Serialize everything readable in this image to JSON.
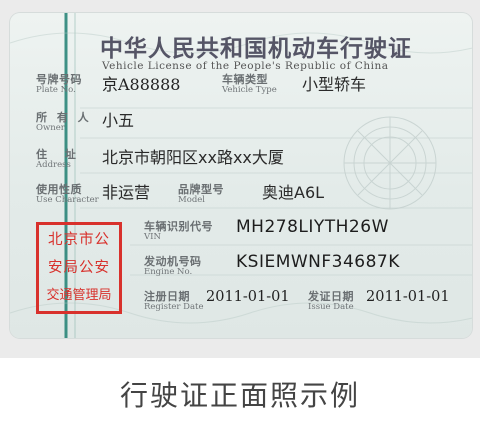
{
  "card": {
    "title_cn": "中华人民共和国机动车行驶证",
    "title_en": "Vehicle License of the People's Republic of China",
    "fields": {
      "plate": {
        "label_cn": "号牌号码",
        "label_en": "Plate No.",
        "value": "京A88888"
      },
      "vehicle_type": {
        "label_cn": "车辆类型",
        "label_en": "Vehicle Type",
        "value": "小型轿车"
      },
      "owner": {
        "label_cn": "所 有 人",
        "label_en": "Owner",
        "value": "小五"
      },
      "address": {
        "label_cn": "住    址",
        "label_en": "Address",
        "value": "北京市朝阳区xx路xx大厦"
      },
      "use_character": {
        "label_cn": "使用性质",
        "label_en": "Use Character",
        "value": "非运营"
      },
      "model": {
        "label_cn": "品牌型号",
        "label_en": "Model",
        "value": "奥迪A6L"
      },
      "vin": {
        "label_cn": "车辆识别代号",
        "label_en": "VIN",
        "value": "MH278LIYTH26W"
      },
      "engine": {
        "label_cn": "发动机号码",
        "label_en": "Engine No.",
        "value": "KSIEMWNF34687K"
      },
      "register_date": {
        "label_cn": "注册日期",
        "label_en": "Register Date",
        "value": "2011-01-01"
      },
      "issue_date": {
        "label_cn": "发证日期",
        "label_en": "Issue Date",
        "value": "2011-01-01"
      }
    },
    "stamp": {
      "lines": [
        "北京市公",
        "安局公安",
        "交通管理局"
      ],
      "color": "#d8312c"
    }
  },
  "caption": "行驶证正面照示例"
}
